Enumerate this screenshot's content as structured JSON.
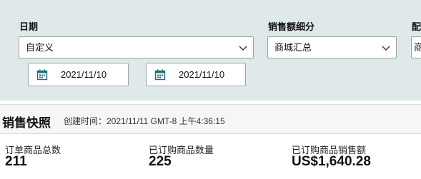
{
  "filters": {
    "date": {
      "label": "日期",
      "selected": "自定义",
      "start_date": "2021/11/10",
      "end_date": "2021/11/10"
    },
    "sales_breakdown": {
      "label": "销售额细分",
      "selected": "商城汇总"
    },
    "fulfillment": {
      "label": "配",
      "selected": "商"
    }
  },
  "snapshot": {
    "title": "销售快照",
    "created_text": "创建时间：2021/11/11 GMT-8 上午4:36:15"
  },
  "metrics": [
    {
      "label": "订单商品总数",
      "value": "211"
    },
    {
      "label": "已订购商品数量",
      "value": "225"
    },
    {
      "label": "已订购商品销售额",
      "value": "US$1,640.28"
    }
  ],
  "icons": {
    "calendar": "calendar-icon",
    "dropdown": "chevron-down-icon"
  },
  "colors": {
    "filter_background": "#dfe9ea",
    "header_background": "#f5f6f6",
    "calendar_icon": "#1f6f7a"
  }
}
